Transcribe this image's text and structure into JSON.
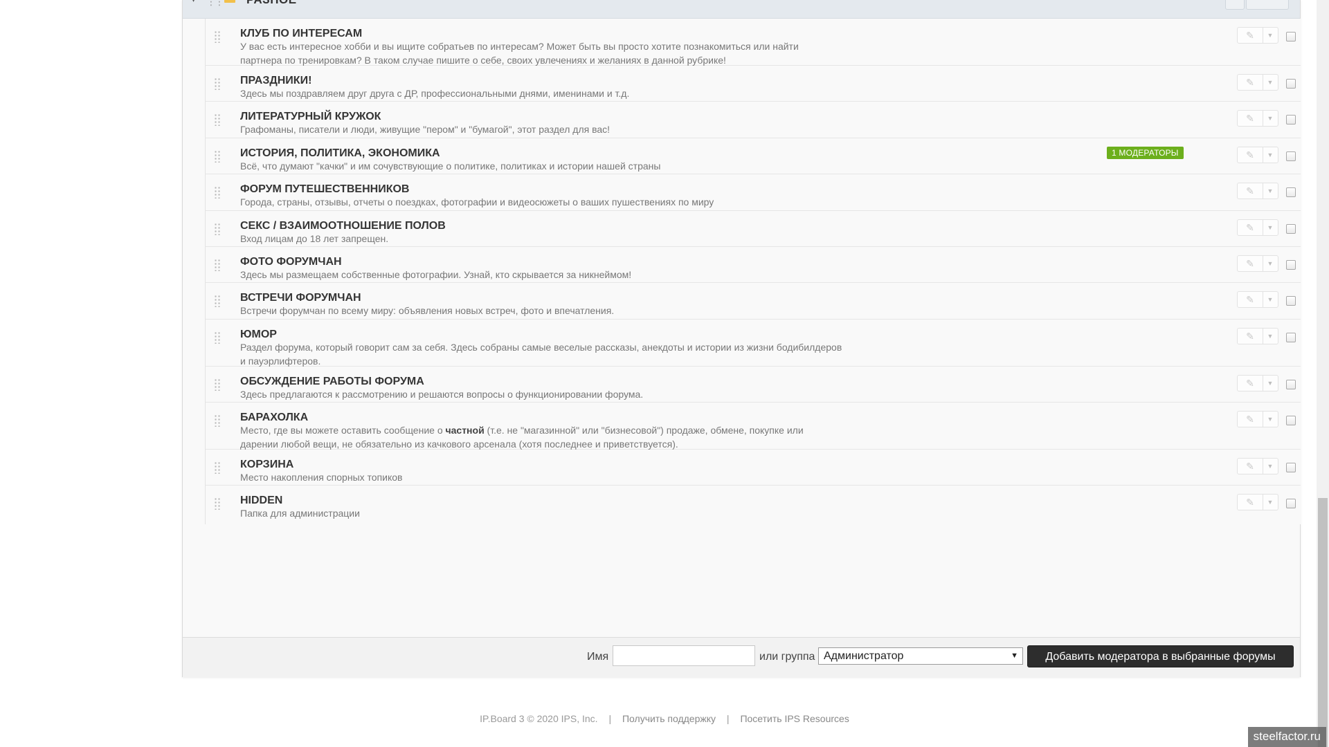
{
  "category": {
    "title": "РАЗНОЕ"
  },
  "forums": [
    {
      "name": "КЛУБ ПО ИНТЕРЕСАМ",
      "desc": "У вас есть интересное хобби и вы ищите собратьев по интересам? Может быть вы просто хотите познакомиться или найти партнера по тренировкам? В таком случае пишите о себе, своих увлечениях и желаниях в данной рубрике!"
    },
    {
      "name": "ПРАЗДНИКИ!",
      "desc": "Здесь мы поздравляем друг друга с ДР, профессиональными днями, именинами и т.д."
    },
    {
      "name": "ЛИТЕРАТУРНЫЙ КРУЖОК",
      "desc": "Графоманы, писатели и люди, живущие \"пером\" и \"бумагой\", этот раздел для вас!"
    },
    {
      "name": "ИСТОРИЯ, ПОЛИТИКА, ЭКОНОМИКА",
      "desc": "Всё, что думают \"качки\" и им сочувствующие о политике, политиках и истории нашей страны",
      "badge": "1 МОДЕРАТОРЫ"
    },
    {
      "name": "ФОРУМ ПУТЕШЕСТВЕННИКОВ",
      "desc": "Города, страны, отзывы, отчеты о поездках, фотографии и видеосюжеты о ваших пушествениях по миру"
    },
    {
      "name": "СЕКС / ВЗАИМООТНОШЕНИЕ ПОЛОВ",
      "desc": "Вход лицам до 18 лет запрещен."
    },
    {
      "name": "ФОТО ФОРУМЧАН",
      "desc": "Здесь мы размещаем собственные фотографии. Узнай, кто скрывается за никнеймом!"
    },
    {
      "name": "ВСТРЕЧИ ФОРУМЧАН",
      "desc": "Встречи форумчан по всему миру: объявления новых встреч, фото и впечатления."
    },
    {
      "name": "ЮМОР",
      "desc": "Раздел форума, который говорит сам за себя. Здесь собраны самые веселые рассказы, анекдоты и истории из жизни бодибилдеров и пауэрлифтеров."
    },
    {
      "name": "ОБСУЖДЕНИЕ РАБОТЫ ФОРУМА",
      "desc": "Здесь предлагаются к рассмотрению и решаются вопросы о функционировании форума."
    },
    {
      "name": "БАРАХОЛКА",
      "desc_before": "Место, где вы можете оставить сообщение о ",
      "desc_bold": "частной",
      "desc_after": " (т.е. не \"магазинной\" или \"бизнесовой\") продаже, обмене, покупке или дарении любой вещи, не обязательно из качкового арсенала (хотя последнее и приветствуется)."
    },
    {
      "name": "КОРЗИНА",
      "desc": "Место накопления спорных топиков"
    },
    {
      "name": "HIDDEN",
      "desc": "Папка для администрации"
    }
  ],
  "footer_bar": {
    "name_label": "Имя",
    "name_value": "",
    "group_label": "или группа",
    "group_selected": "Администратор",
    "add_button": "Добавить модератора в выбранные форумы"
  },
  "page_footer": {
    "copyright": "IP.Board 3 © 2020 IPS, Inc.",
    "sep1": "|",
    "support_link": "Получить поддержку",
    "sep2": "|",
    "resources_link": "Посетить IPS Resources"
  },
  "watermark": "steelfactor.ru",
  "icons": {
    "edit": "pencil-icon",
    "dropdown": "caret-down-icon",
    "handle": "drag-handle-icon",
    "folder": "folder-icon"
  },
  "colors": {
    "badge": "#6caf1c",
    "button": "#2d2d2d"
  }
}
